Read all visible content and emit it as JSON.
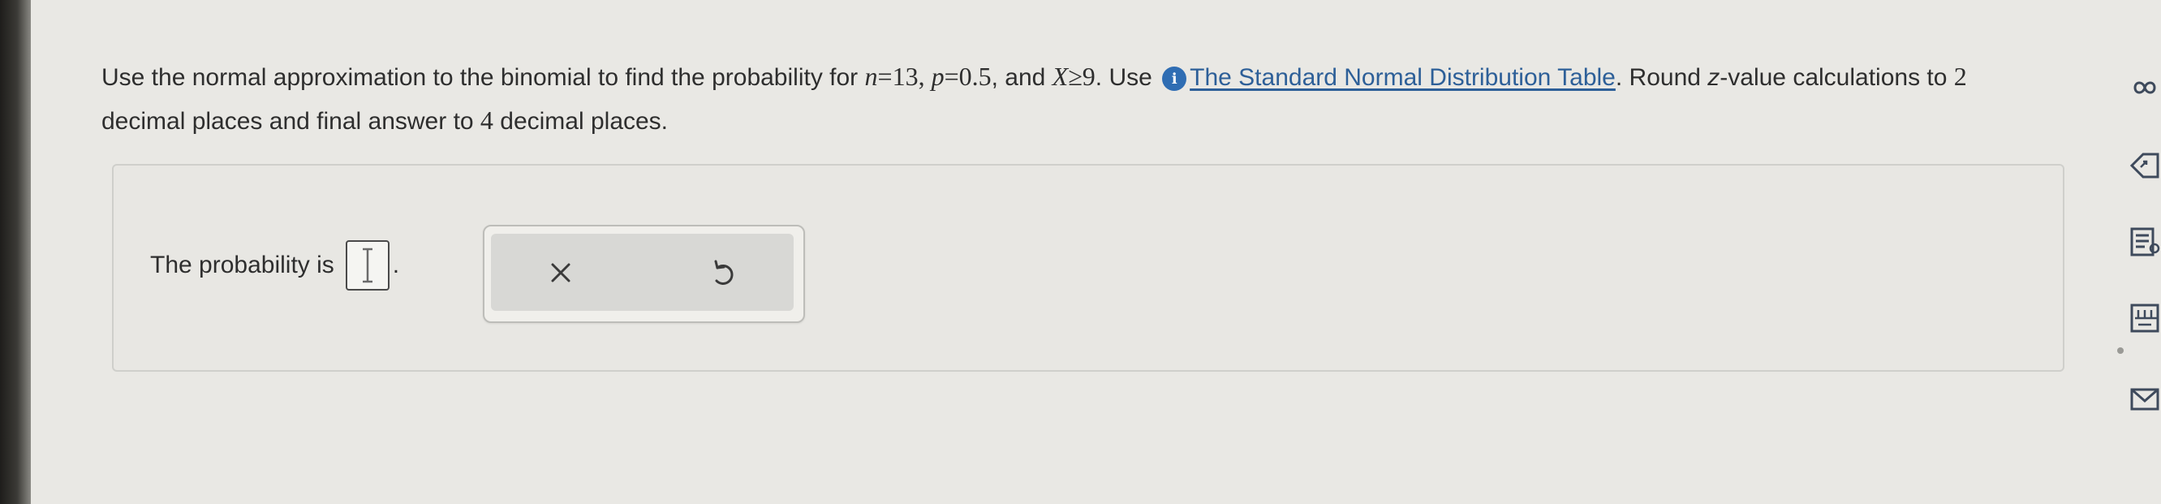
{
  "question": {
    "intro": "Use the normal approximation to the binomial to find the probability for ",
    "n_var": "n",
    "n_eq": "=13, ",
    "p_var": "p",
    "p_eq": "=0.5",
    "and_text": ", and ",
    "x_var": "X",
    "x_cond": "≥9",
    "use_text": ". Use ",
    "info_icon": "info-icon",
    "table_link": "The Standard Normal Distribution Table",
    "round_text": ". Round ",
    "z_var": "z",
    "rest_text": "-value calculations to ",
    "two": "2",
    "decimals_text": " decimal places and final answer to ",
    "four": "4",
    "final_text": " decimal places."
  },
  "answer": {
    "prompt": "The probability is",
    "value": "",
    "period": "."
  },
  "tools": {
    "clear_icon": "close-icon",
    "undo_icon": "undo-icon"
  },
  "sidebar_icons": [
    "infinity-icon",
    "tag-icon",
    "notes-icon",
    "calculator-icon",
    "mail-icon"
  ],
  "colors": {
    "link": "#2d5f98",
    "info_icon": "#2f6db3",
    "background": "#e9e8e4"
  }
}
